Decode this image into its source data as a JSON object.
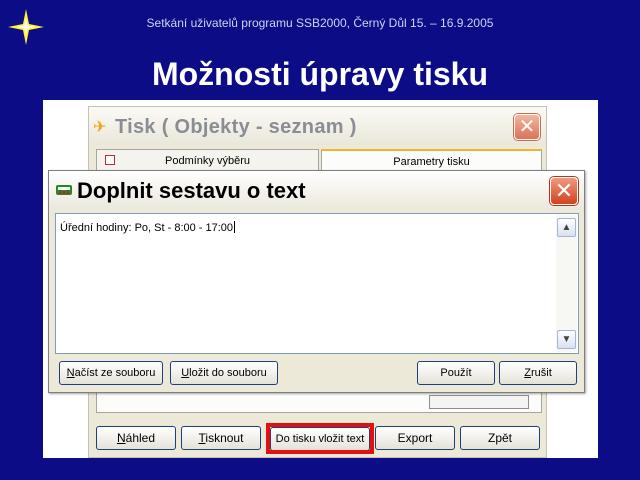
{
  "slide": {
    "subtitle": "Setkání uživatelů programu SSB2000, Černý Důl 15. – 16.9.2005",
    "title": "Možnosti úpravy tisku"
  },
  "background_window": {
    "title": "Tisk ( Objekty - seznam )",
    "close_icon": "close-icon",
    "tabs": [
      {
        "label": "Podmínky výběru",
        "active": false
      },
      {
        "label": "Parametry tisku",
        "active": true
      }
    ],
    "buttons": [
      {
        "accel": "N",
        "rest": "áhled"
      },
      {
        "accel": "T",
        "rest": "isknout"
      },
      {
        "label": "Do tisku vložit text",
        "highlighted": true
      },
      {
        "label": "Export"
      },
      {
        "label": "Zpět"
      }
    ]
  },
  "dialog": {
    "title": "Doplnit sestavu o text",
    "text_value": "Úřední hodiny: Po, St - 8:00 - 17:00",
    "buttons": {
      "load": {
        "accel": "N",
        "rest": "ačíst ze souboru"
      },
      "save": {
        "accel": "U",
        "rest": "ložit do souboru"
      },
      "apply": {
        "accel": "",
        "rest": "Použít"
      },
      "cancel": {
        "accel": "Z",
        "rest": "rušit"
      }
    }
  },
  "colors": {
    "slide_background": "#0b0c86",
    "highlight": "#e21010",
    "close_button": "#d2421f",
    "accent_tab": "#f1b336"
  }
}
